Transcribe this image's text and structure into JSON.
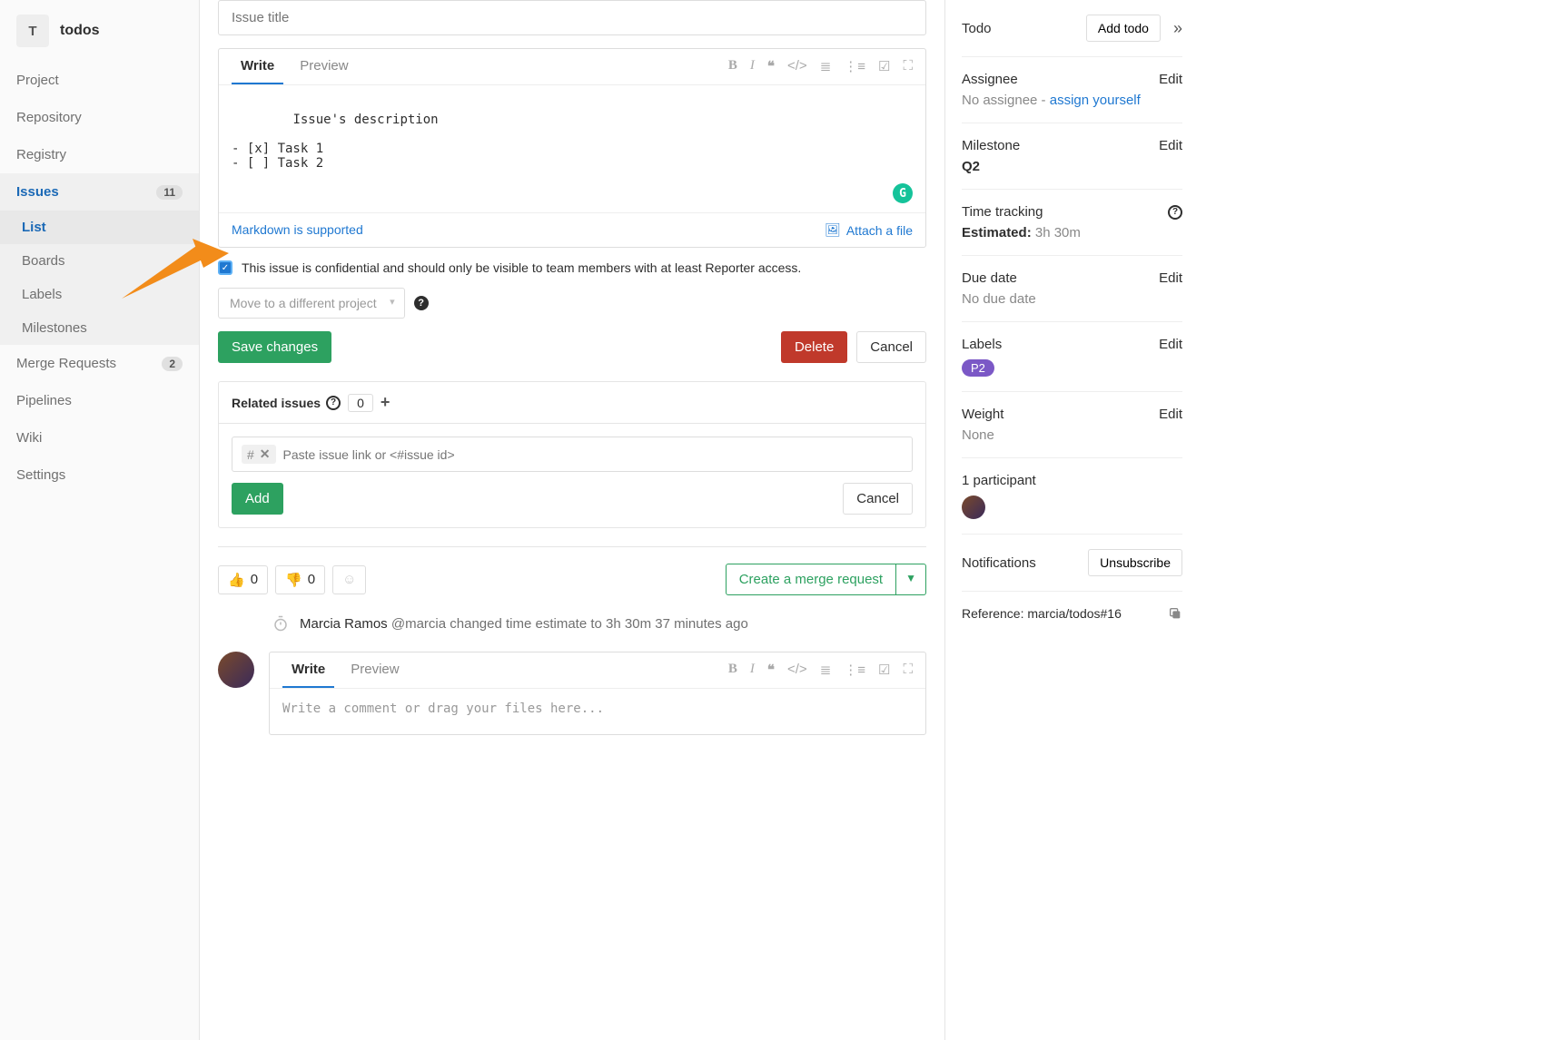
{
  "project": {
    "initial": "T",
    "name": "todos"
  },
  "sidebar": {
    "items": [
      {
        "label": "Project"
      },
      {
        "label": "Repository"
      },
      {
        "label": "Registry"
      },
      {
        "label": "Issues",
        "badge": "11"
      },
      {
        "label": "Merge Requests",
        "badge": "2"
      },
      {
        "label": "Pipelines"
      },
      {
        "label": "Wiki"
      },
      {
        "label": "Settings"
      }
    ],
    "issues_sub": [
      {
        "label": "List"
      },
      {
        "label": "Boards"
      },
      {
        "label": "Labels"
      },
      {
        "label": "Milestones"
      }
    ]
  },
  "issue": {
    "title_placeholder": "Issue title",
    "write_tab": "Write",
    "preview_tab": "Preview",
    "body": "Issue's description\n\n- [x] Task 1\n- [ ] Task 2",
    "markdown_link": "Markdown is supported",
    "attach_link": "Attach a file",
    "confidential_text": "This issue is confidential and should only be visible to team members with at least Reporter access.",
    "move_placeholder": "Move to a different project",
    "save_btn": "Save changes",
    "delete_btn": "Delete",
    "cancel_btn": "Cancel"
  },
  "related": {
    "title": "Related issues",
    "count": "0",
    "input_placeholder": "Paste issue link or <#issue id>",
    "hash": "#",
    "add_btn": "Add",
    "cancel_btn": "Cancel"
  },
  "reactions": {
    "thumbs_up": "0",
    "thumbs_down": "0",
    "mr_btn": "Create a merge request"
  },
  "activity": {
    "author": "Marcia Ramos",
    "handle": "@marcia",
    "text": "changed time estimate to 3h 30m 37 minutes ago"
  },
  "comment": {
    "write_tab": "Write",
    "preview_tab": "Preview",
    "placeholder": "Write a comment or drag your files here..."
  },
  "right": {
    "todo_label": "Todo",
    "add_todo_btn": "Add todo",
    "assignee_label": "Assignee",
    "assignee_value": "No assignee -",
    "assign_yourself": "assign yourself",
    "milestone_label": "Milestone",
    "milestone_value": "Q2",
    "tt_label": "Time tracking",
    "tt_estimated_label": "Estimated:",
    "tt_estimated_value": "3h 30m",
    "due_label": "Due date",
    "due_value": "No due date",
    "labels_label": "Labels",
    "labels_value": "P2",
    "weight_label": "Weight",
    "weight_value": "None",
    "participants": "1 participant",
    "notifications_label": "Notifications",
    "unsubscribe_btn": "Unsubscribe",
    "reference_label": "Reference:",
    "reference_value": "marcia/todos#16",
    "edit": "Edit"
  }
}
